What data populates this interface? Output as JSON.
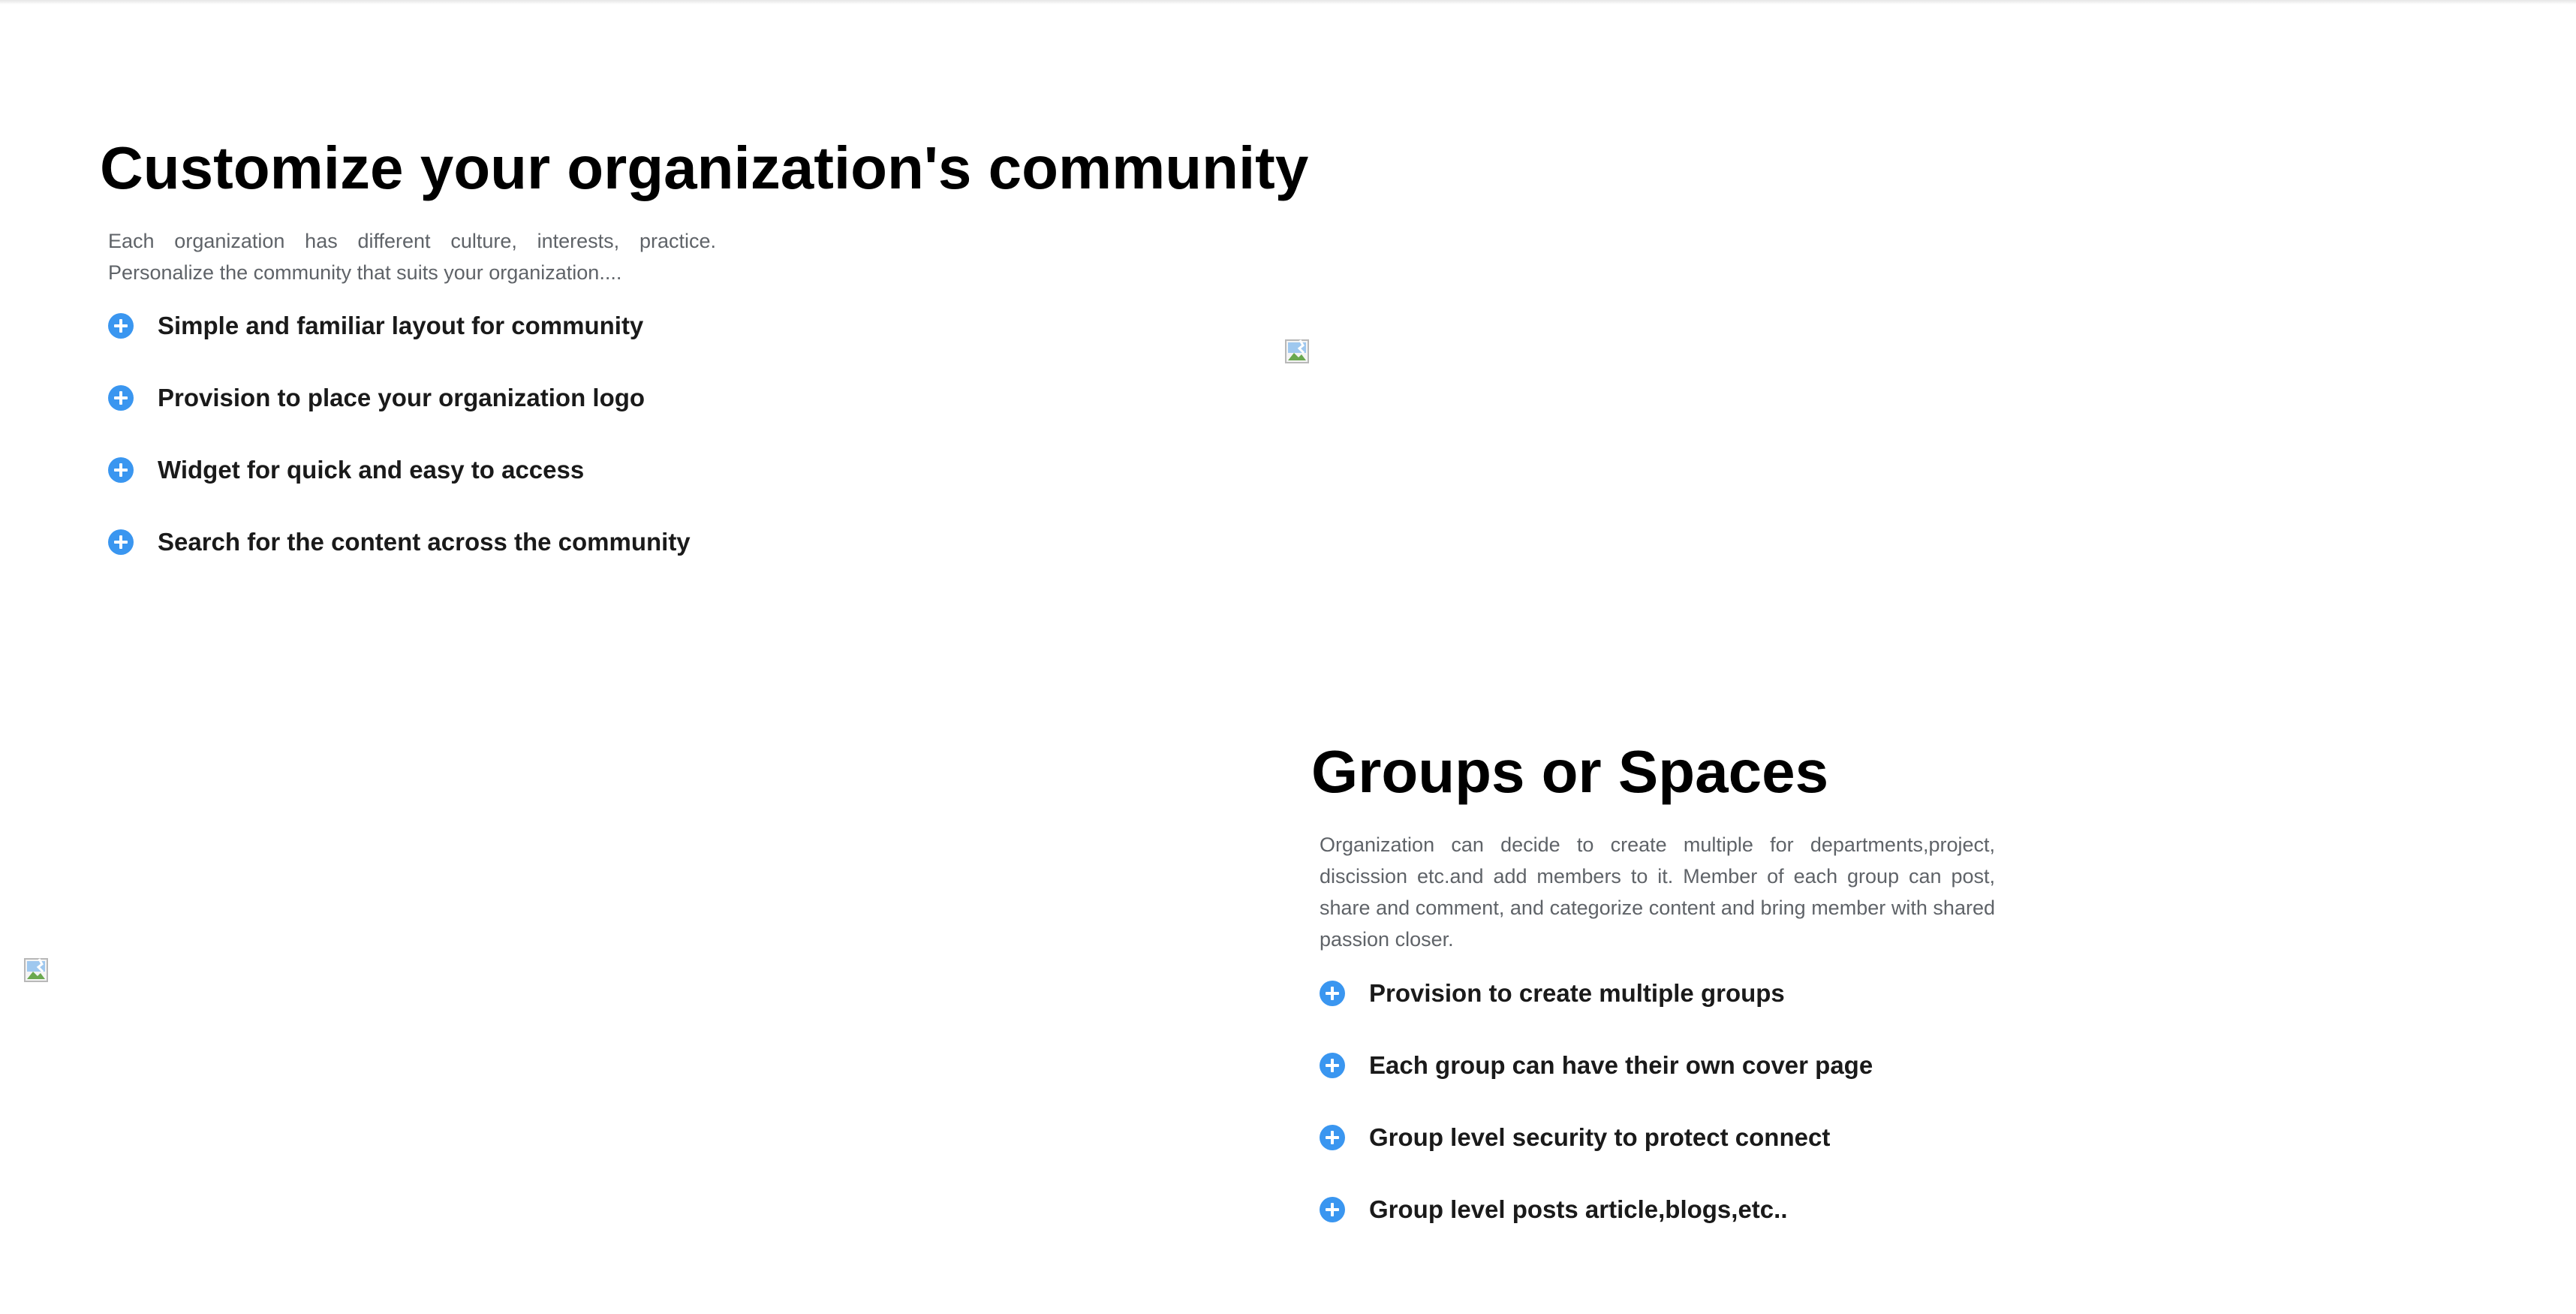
{
  "colors": {
    "accent": "#3a96f0",
    "title": "#000000",
    "description": "#5f6368",
    "feature_text": "#1a1a1a"
  },
  "section1": {
    "title": "Customize your organization's community",
    "description": "Each organization has different culture, interests, practice. Personalize the community that suits your organization....",
    "features": [
      {
        "icon": "plus-circle-icon",
        "label": "Simple and familiar layout for community"
      },
      {
        "icon": "plus-circle-icon",
        "label": "Provision to place your organization logo"
      },
      {
        "icon": "plus-circle-icon",
        "label": "Widget for quick and easy to access"
      },
      {
        "icon": "plus-circle-icon",
        "label": "Search for the content across the community"
      }
    ],
    "image_icon": "broken-image-icon"
  },
  "section2": {
    "title": "Groups or Spaces",
    "description": "Organization can decide to create multiple for departments,project, discission etc.and add members to it. Member of each group can post, share and comment, and categorize content and bring member with shared passion closer.",
    "features": [
      {
        "icon": "plus-circle-icon",
        "label": "Provision to create multiple groups"
      },
      {
        "icon": "plus-circle-icon",
        "label": "Each group can have their own cover page"
      },
      {
        "icon": "plus-circle-icon",
        "label": "Group level security to protect connect"
      },
      {
        "icon": "plus-circle-icon",
        "label": "Group level posts article,blogs,etc.."
      }
    ],
    "image_icon": "broken-image-icon"
  }
}
